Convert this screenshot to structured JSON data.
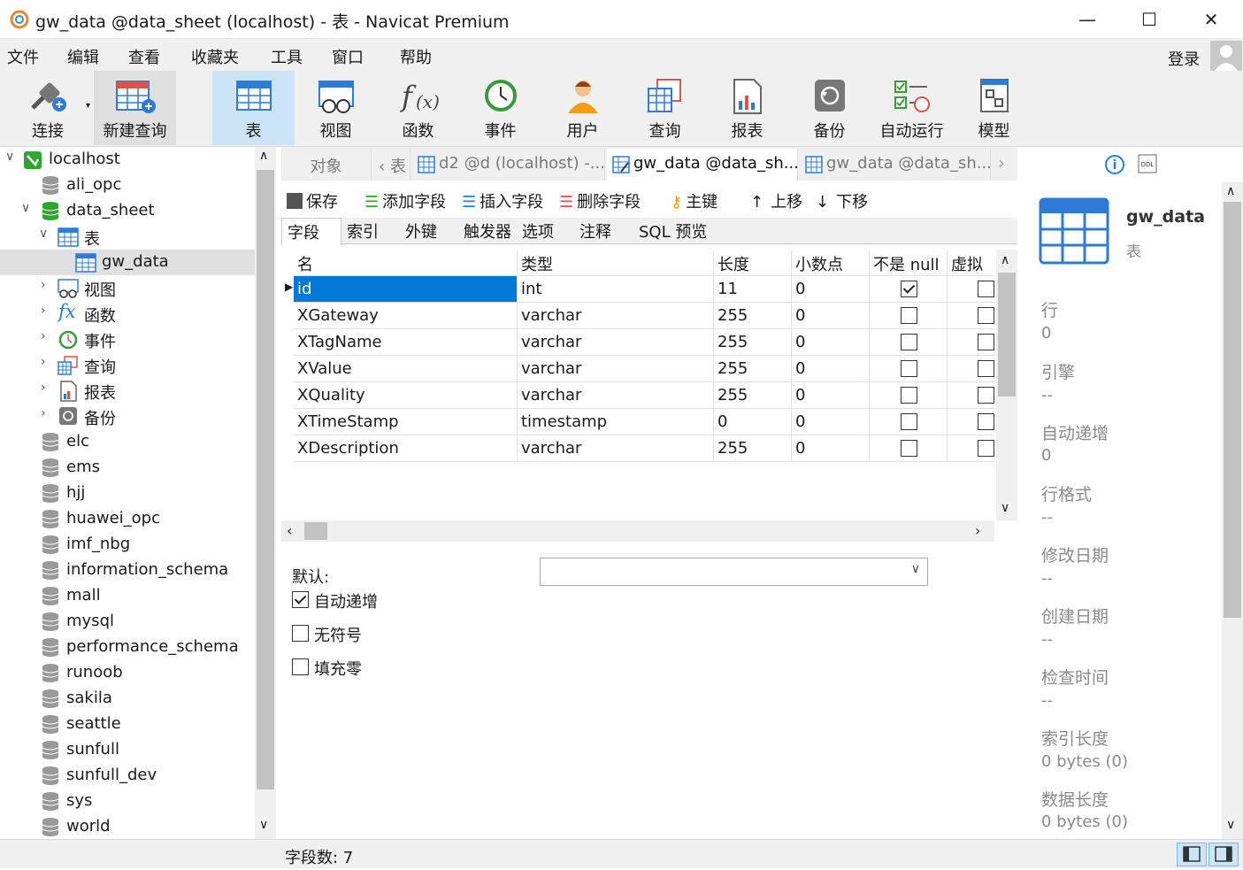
{
  "window": {
    "title": "gw_data @data_sheet (localhost) - 表 - Navicat Premium",
    "minimize": "—",
    "maximize": "☐",
    "close": "✕"
  },
  "menu": [
    "文件",
    "编辑",
    "查看",
    "收藏夹",
    "工具",
    "窗口",
    "帮助"
  ],
  "login": "登录",
  "toolbar": [
    "连接",
    "新建查询",
    "表",
    "视图",
    "函数",
    "事件",
    "用户",
    "查询",
    "报表",
    "备份",
    "自动运行",
    "模型"
  ],
  "tree": {
    "server": "localhost",
    "db_ali": "ali_opc",
    "db_data": "data_sheet",
    "node_table": "表",
    "table_gw": "gw_data",
    "node_view": "视图",
    "node_func": "函数",
    "node_event": "事件",
    "node_query": "查询",
    "node_report": "报表",
    "node_backup": "备份",
    "dbs": [
      "elc",
      "ems",
      "hjj",
      "huawei_opc",
      "imf_nbg",
      "information_schema",
      "mall",
      "mysql",
      "performance_schema",
      "runoob",
      "sakila",
      "seattle",
      "sunfull",
      "sunfull_dev",
      "sys",
      "world"
    ]
  },
  "tabs": {
    "objects": "对象",
    "t1": "表",
    "t2": "d2 @d (localhost) -...",
    "t3": "gw_data @data_sh...",
    "t4": "gw_data @data_sh..."
  },
  "edit_toolbar": {
    "save": "保存",
    "add": "添加字段",
    "insert": "插入字段",
    "delete": "删除字段",
    "pk": "主键",
    "up": "上移",
    "down": "下移"
  },
  "subtabs": [
    "字段",
    "索引",
    "外键",
    "触发器",
    "选项",
    "注释",
    "SQL 预览"
  ],
  "grid": {
    "headers": [
      "名",
      "类型",
      "长度",
      "小数点",
      "不是 null",
      "虚拟"
    ],
    "rows": [
      {
        "name": "id",
        "type": "int",
        "len": "11",
        "dec": "0",
        "notnull": true
      },
      {
        "name": "XGateway",
        "type": "varchar",
        "len": "255",
        "dec": "0",
        "notnull": false
      },
      {
        "name": "XTagName",
        "type": "varchar",
        "len": "255",
        "dec": "0",
        "notnull": false
      },
      {
        "name": "XValue",
        "type": "varchar",
        "len": "255",
        "dec": "0",
        "notnull": false
      },
      {
        "name": "XQuality",
        "type": "varchar",
        "len": "255",
        "dec": "0",
        "notnull": false
      },
      {
        "name": "XTimeStamp",
        "type": "timestamp",
        "len": "0",
        "dec": "0",
        "notnull": false
      },
      {
        "name": "XDescription",
        "type": "varchar",
        "len": "255",
        "dec": "0",
        "notnull": false
      }
    ]
  },
  "props": {
    "default_label": "默认:",
    "auto_inc": "自动递增",
    "unsigned": "无符号",
    "zerofill": "填充零",
    "auto_inc_checked": true,
    "unsigned_checked": false,
    "zerofill_checked": false
  },
  "right": {
    "name": "gw_data",
    "kind": "表",
    "rows_label": "行",
    "rows": "0",
    "engine_label": "引擎",
    "engine": "--",
    "autoinc_label": "自动递增",
    "autoinc": "0",
    "rowfmt_label": "行格式",
    "rowfmt": "--",
    "modified_label": "修改日期",
    "modified": "--",
    "created_label": "创建日期",
    "created": "--",
    "checked_label": "检查时间",
    "checked": "--",
    "idxlen_label": "索引长度",
    "idxlen": "0 bytes (0)",
    "datalen_label": "数据长度",
    "datalen": "0 bytes (0)"
  },
  "status": {
    "fields": "字段数: 7"
  }
}
